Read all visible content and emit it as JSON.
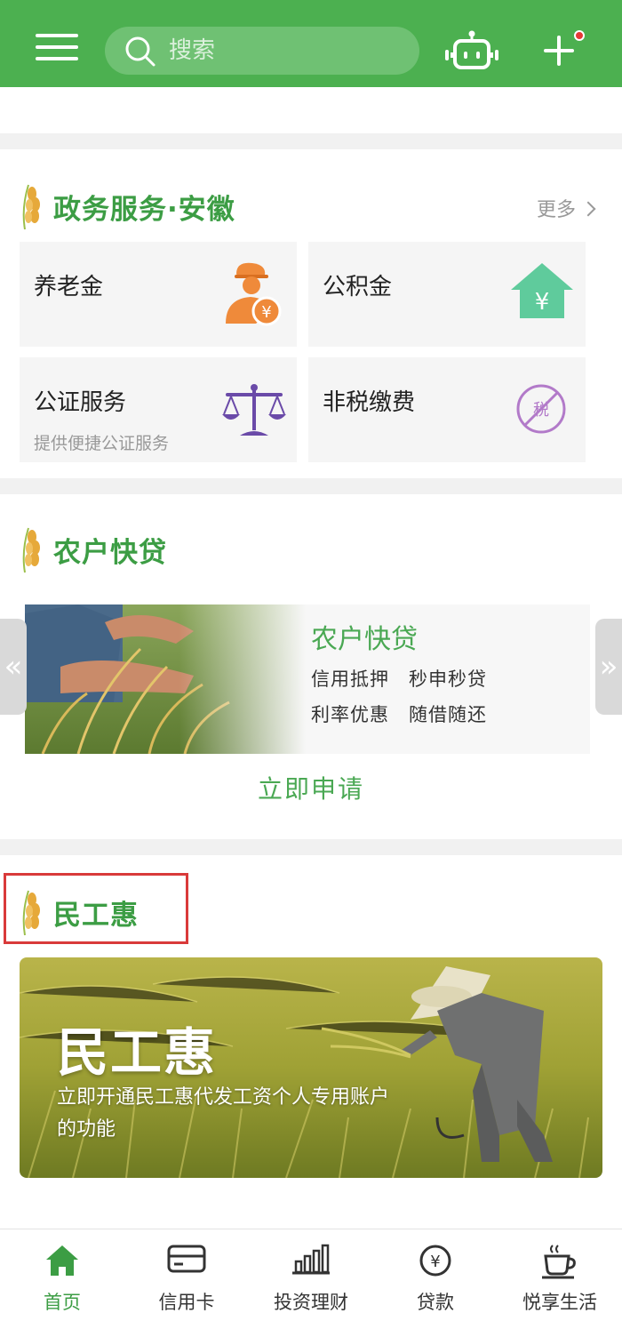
{
  "header": {
    "search_placeholder": "搜索",
    "bg_color": "#4cb050"
  },
  "gov_section": {
    "title": "政务服务·安徽",
    "more": "更多",
    "tiles": [
      {
        "title": "养老金",
        "subtitle": "",
        "icon": "pension-person-icon"
      },
      {
        "title": "公积金",
        "subtitle": "",
        "icon": "house-yen-icon"
      },
      {
        "title": "公证服务",
        "subtitle": "提供便捷公证服务",
        "icon": "scales-icon"
      },
      {
        "title": "非税缴费",
        "subtitle": "",
        "icon": "no-tax-icon"
      }
    ]
  },
  "loan_section": {
    "title": "农户快贷",
    "banner_title": "农户快贷",
    "banner_line1": "信用抵押　秒申秒贷",
    "banner_line2": "利率优惠　随借随还",
    "apply": "立即申请"
  },
  "worker_section": {
    "title": "民工惠",
    "banner_title": "民工惠",
    "banner_desc": "立即开通民工惠代发工资个人专用账户的功能"
  },
  "bottom_nav": [
    {
      "label": "首页",
      "icon": "home-icon",
      "active": true
    },
    {
      "label": "信用卡",
      "icon": "credit-card-icon",
      "active": false
    },
    {
      "label": "投资理财",
      "icon": "bar-chart-icon",
      "active": false
    },
    {
      "label": "贷款",
      "icon": "yen-coin-icon",
      "active": false
    },
    {
      "label": "悦享生活",
      "icon": "coffee-cup-icon",
      "active": false
    }
  ],
  "colors": {
    "brand_green": "#4cb050",
    "title_green": "#3c9d44",
    "highlight_red": "#d93a3a"
  }
}
